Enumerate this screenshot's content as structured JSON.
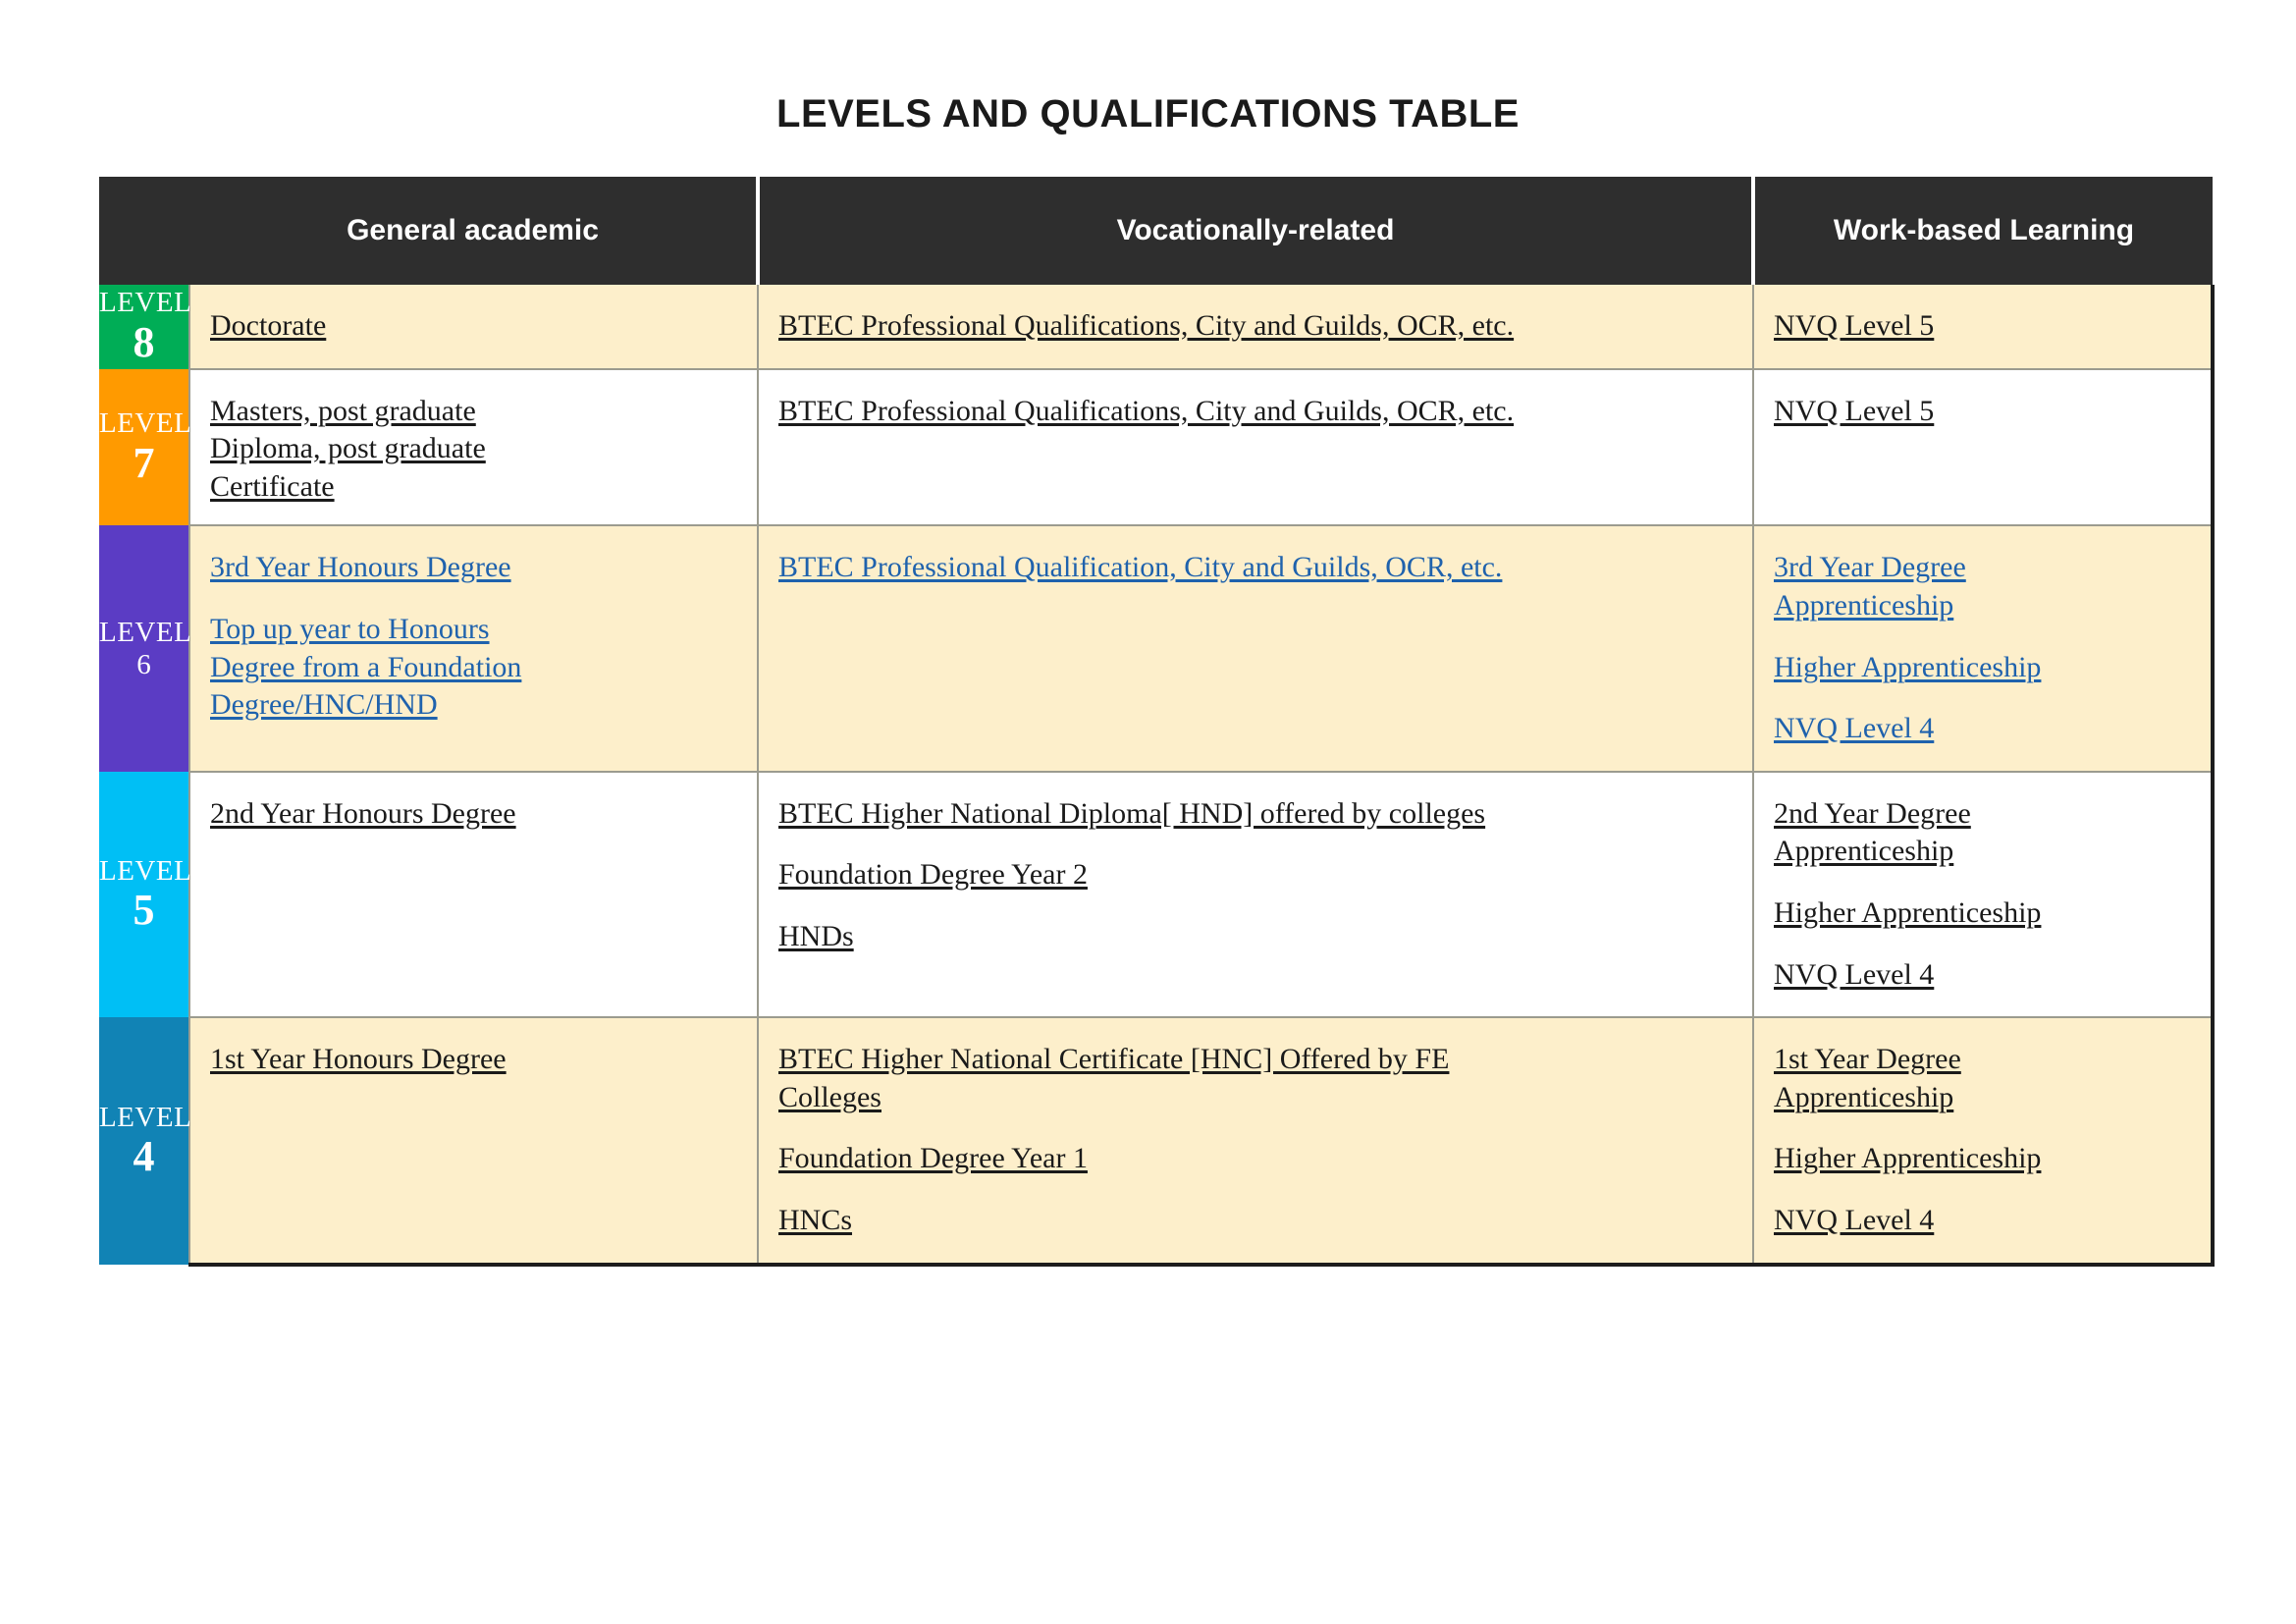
{
  "document": {
    "title": "LEVELS AND QUALIFICATIONS TABLE"
  },
  "table": {
    "headers": {
      "level": "",
      "general_academic": "General academic",
      "vocationally_related": "Vocationally-related",
      "work_based_learning": "Work-based Learning"
    },
    "colors": {
      "header_background": "#2e2e2e",
      "cream_row": "#fdefcb",
      "white_row": "#ffffff",
      "link_blue": "#1f62ad",
      "grid_line": "#9b9b8f",
      "outer_border": "#1d1d1d"
    },
    "rows": [
      {
        "level_word": "LEVEL",
        "level_number": "8",
        "badge_color": "#00ad56",
        "row_fill": "cream",
        "general_academic": [
          "Doctorate"
        ],
        "vocationally_related": [
          "BTEC Professional Qualifications, City and Guilds, OCR, etc."
        ],
        "work_based_learning": [
          "NVQ Level 5"
        ],
        "link_style": false
      },
      {
        "level_word": "LEVEL",
        "level_number": "7",
        "badge_color": "#ff9a00",
        "row_fill": "white",
        "general_academic": [
          "Masters, post graduate",
          "Diploma, post graduate",
          "Certificate"
        ],
        "vocationally_related": [
          "BTEC Professional Qualifications, City and Guilds, OCR, etc."
        ],
        "work_based_learning": [
          "NVQ Level 5"
        ],
        "link_style": false
      },
      {
        "level_word": "LEVEL",
        "level_number": "6",
        "badge_color": "#5b3cc4",
        "row_fill": "cream",
        "general_academic": [
          "3rd Year Honours Degree",
          "Top up year to Honours",
          "Degree from a Foundation",
          "Degree/HNC/HND"
        ],
        "vocationally_related": [
          "BTEC Professional Qualification, City and Guilds, OCR, etc."
        ],
        "work_based_learning": [
          "3rd Year Degree",
          "Apprenticeship",
          "Higher Apprenticeship",
          "NVQ Level 4"
        ],
        "link_style": true
      },
      {
        "level_word": "LEVEL",
        "level_number": "5",
        "badge_color": "#00bff5",
        "row_fill": "white",
        "general_academic": [
          "2nd Year Honours Degree"
        ],
        "vocationally_related": [
          "BTEC Higher National Diploma[ HND] offered by colleges",
          "Foundation Degree Year 2",
          "HNDs"
        ],
        "work_based_learning": [
          "2nd Year Degree",
          "Apprenticeship",
          "Higher Apprenticeship",
          "NVQ Level 4"
        ],
        "link_style": false
      },
      {
        "level_word": "LEVEL",
        "level_number": "4",
        "badge_color": "#1183b5",
        "row_fill": "cream",
        "general_academic": [
          "1st Year Honours Degree"
        ],
        "vocationally_related": [
          "BTEC Higher National Certificate [HNC] Offered by FE",
          "Colleges",
          "Foundation Degree Year 1",
          "HNCs"
        ],
        "work_based_learning": [
          "1st Year Degree",
          "Apprenticeship",
          "Higher Apprenticeship",
          "NVQ Level 4"
        ],
        "link_style": false
      }
    ]
  }
}
